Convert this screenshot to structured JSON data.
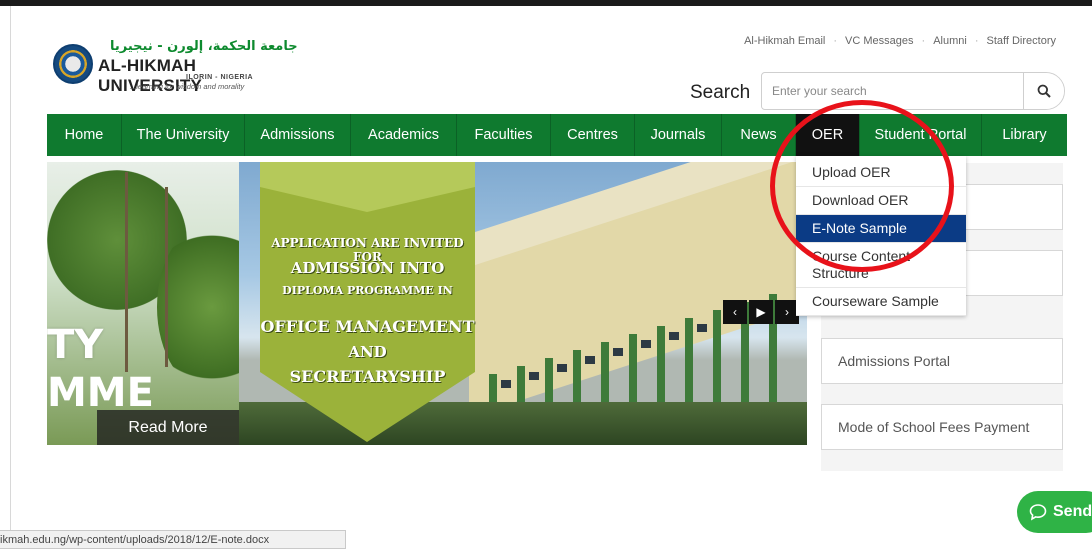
{
  "header": {
    "arabic_name": "جامعة الحكمة، إلورن - نيجيريا",
    "university_name": "AL-HIKMAH UNIVERSITY",
    "location": "ILORIN - NIGERIA",
    "motto": "...learning for wisdom and morality",
    "top_links": [
      "Al-Hikmah Email",
      "VC Messages",
      "Alumni",
      "Staff Directory"
    ]
  },
  "search": {
    "label": "Search",
    "placeholder": "Enter your search",
    "icon": "search-icon"
  },
  "nav": {
    "items": [
      {
        "label": "Home",
        "w": 75
      },
      {
        "label": "The University",
        "w": 123
      },
      {
        "label": "Admissions",
        "w": 106
      },
      {
        "label": "Academics",
        "w": 106
      },
      {
        "label": "Faculties",
        "w": 94
      },
      {
        "label": "Centres",
        "w": 84
      },
      {
        "label": "Journals",
        "w": 87
      },
      {
        "label": "News",
        "w": 74
      },
      {
        "label": "OER",
        "w": 64
      },
      {
        "label": "Student Portal",
        "w": 122
      },
      {
        "label": "Library",
        "w": 85
      }
    ],
    "active": "OER",
    "colors": {
      "bar": "#0f7a2f",
      "active": "#111111",
      "selected_item": "#0b3b85",
      "highlight_circle": "#e8121a"
    }
  },
  "oer_dropdown": {
    "items": [
      "Upload OER",
      "Download OER",
      "E-Note Sample",
      "Course Content Structure",
      "Courseware Sample"
    ],
    "selected": "E-Note Sample"
  },
  "slider": {
    "left_slide_text_1": "TY",
    "left_slide_text_2": "MME",
    "read_more": "Read More",
    "banner_line1": "APPLICATION ARE INVITED FOR",
    "banner_line2": "ADMISSION INTO",
    "banner_line3": "DIPLOMA PROGRAMME IN",
    "banner_line4": "OFFICE MANAGEMENT",
    "banner_line5": "AND",
    "banner_line6": "SECRETARYSHIP",
    "prev": "‹",
    "play": "▶",
    "next": "›"
  },
  "sidebar": {
    "items": [
      "Admissions Portal",
      "Mode of School Fees Payment"
    ]
  },
  "status_bar": {
    "url": "ikmah.edu.ng/wp-content/uploads/2018/12/E-note.docx"
  },
  "chat": {
    "label": "Send"
  }
}
